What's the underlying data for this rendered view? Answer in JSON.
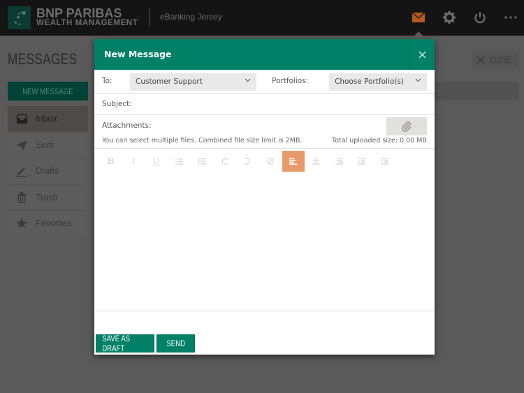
{
  "header": {
    "brand_line1": "BNP PARIBAS",
    "brand_line2": "WEALTH MANAGEMENT",
    "site_name": "eBanking Jersey",
    "icons": [
      "mail-icon",
      "gear-icon",
      "power-icon",
      "more-icon"
    ],
    "accent_color": "#b35a1f"
  },
  "page": {
    "title": "MESSAGES",
    "new_message_label": "NEW MESSAGE",
    "close_label": "CLOSE",
    "sidebar": {
      "items": [
        {
          "label": "Inbox",
          "icon": "inbox-icon",
          "active": true
        },
        {
          "label": "Sent",
          "icon": "paper-plane-icon",
          "active": false
        },
        {
          "label": "Drafts",
          "icon": "pencil-icon",
          "active": false
        },
        {
          "label": "Trash",
          "icon": "trash-icon",
          "active": false
        },
        {
          "label": "Favorites",
          "icon": "star-icon",
          "active": false
        }
      ]
    }
  },
  "modal": {
    "title": "New Message",
    "to_label": "To:",
    "to_value": "Customer Support",
    "portfolios_label": "Portfolios:",
    "portfolios_value": "Choose Portfolio(s)",
    "subject_label": "Subject:",
    "subject_value": "",
    "attachments_label": "Attachments:",
    "attachments_hint": "You can select multiple files. Combined file size limit is 2MB.",
    "total_uploaded": "Total uploaded size: 0.00 MB",
    "toolbar": [
      {
        "name": "bold",
        "glyph": "B",
        "active": false
      },
      {
        "name": "italic",
        "glyph": "I",
        "active": false
      },
      {
        "name": "underline",
        "glyph": "U",
        "active": false
      },
      {
        "name": "bullet-list",
        "glyph": "",
        "active": false
      },
      {
        "name": "numbered-list",
        "glyph": "",
        "active": false
      },
      {
        "name": "redo",
        "glyph": "",
        "active": false
      },
      {
        "name": "undo",
        "glyph": "",
        "active": false
      },
      {
        "name": "clear-format",
        "glyph": "",
        "active": false
      },
      {
        "name": "align-left",
        "glyph": "",
        "active": true
      },
      {
        "name": "align-center",
        "glyph": "",
        "active": false
      },
      {
        "name": "align-right",
        "glyph": "",
        "active": false
      },
      {
        "name": "outdent",
        "glyph": "",
        "active": false
      },
      {
        "name": "indent",
        "glyph": "",
        "active": false
      }
    ],
    "save_draft_label": "SAVE AS DRAFT",
    "send_label": "SEND",
    "accent_color": "#008066",
    "active_tool_color": "#e8996a"
  }
}
